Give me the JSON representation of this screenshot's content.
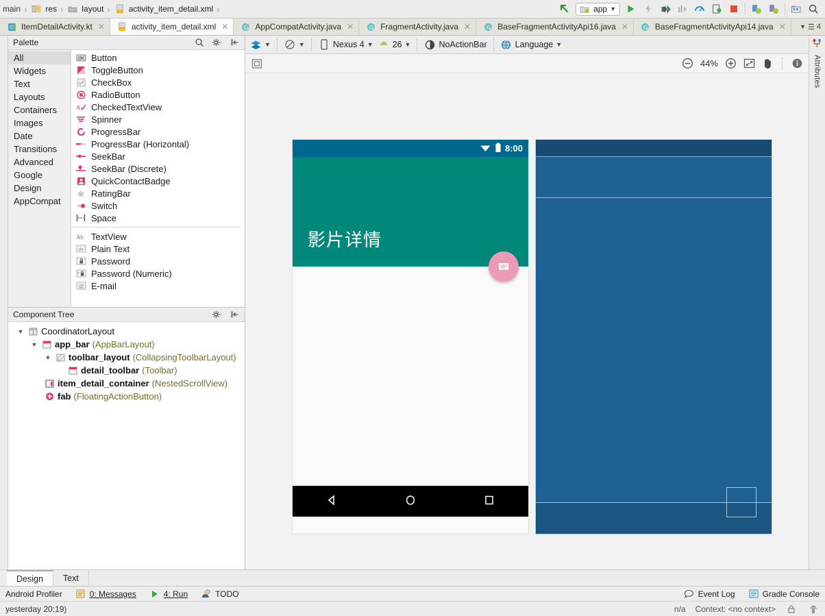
{
  "breadcrumb": {
    "items": [
      {
        "label": "main",
        "icon": "folder-icon"
      },
      {
        "label": "res",
        "icon": "res-folder-icon"
      },
      {
        "label": "layout",
        "icon": "folder-icon"
      },
      {
        "label": "activity_item_detail.xml",
        "icon": "xml-file-icon"
      }
    ],
    "separator": "›"
  },
  "toolbar": {
    "run_config_label": "app",
    "icons": [
      "pointer-icon",
      "run-icon",
      "apply-changes-icon",
      "debug-icon",
      "profile-icon",
      "monitor-icon",
      "attach-debugger-icon",
      "stop-icon",
      "avd-manager-icon",
      "sdk-manager-icon",
      "project-structure-icon",
      "search-everywhere-icon"
    ]
  },
  "editor_tabs": [
    {
      "label": "ItemDetailActivity.kt",
      "icon": "kotlin-file-icon",
      "active": false
    },
    {
      "label": "activity_item_detail.xml",
      "icon": "xml-file-icon",
      "active": true
    },
    {
      "label": "AppCompatActivity.java",
      "icon": "java-class-icon",
      "active": false
    },
    {
      "label": "FragmentActivity.java",
      "icon": "java-class-icon",
      "active": false
    },
    {
      "label": "BaseFragmentActivityApi16.java",
      "icon": "java-class-icon",
      "active": false
    },
    {
      "label": "BaseFragmentActivityApi14.java",
      "icon": "java-class-icon",
      "active": false
    }
  ],
  "tabstrip_right": {
    "count": "4",
    "icon": "tab-list-icon"
  },
  "palette": {
    "title": "Palette",
    "header_icons": [
      "search-icon",
      "gear-icon",
      "collapse-icon"
    ],
    "categories": [
      {
        "label": "All",
        "selected": true
      },
      {
        "label": "Widgets",
        "selected": false
      },
      {
        "label": "Text",
        "selected": false
      },
      {
        "label": "Layouts",
        "selected": false
      },
      {
        "label": "Containers",
        "selected": false
      },
      {
        "label": "Images",
        "selected": false
      },
      {
        "label": "Date",
        "selected": false
      },
      {
        "label": "Transitions",
        "selected": false
      },
      {
        "label": "Advanced",
        "selected": false
      },
      {
        "label": "Google",
        "selected": false
      },
      {
        "label": "Design",
        "selected": false
      },
      {
        "label": "AppCompat",
        "selected": false
      }
    ],
    "group1": [
      {
        "label": "Button",
        "icon": "button-icon"
      },
      {
        "label": "ToggleButton",
        "icon": "toggle-button-icon"
      },
      {
        "label": "CheckBox",
        "icon": "checkbox-icon"
      },
      {
        "label": "RadioButton",
        "icon": "radio-button-icon"
      },
      {
        "label": "CheckedTextView",
        "icon": "checked-text-view-icon"
      },
      {
        "label": "Spinner",
        "icon": "spinner-icon"
      },
      {
        "label": "ProgressBar",
        "icon": "progress-bar-icon"
      },
      {
        "label": "ProgressBar (Horizontal)",
        "icon": "progress-bar-horizontal-icon"
      },
      {
        "label": "SeekBar",
        "icon": "seekbar-icon"
      },
      {
        "label": "SeekBar (Discrete)",
        "icon": "seekbar-discrete-icon"
      },
      {
        "label": "QuickContactBadge",
        "icon": "quick-contact-badge-icon"
      },
      {
        "label": "RatingBar",
        "icon": "rating-bar-icon"
      },
      {
        "label": "Switch",
        "icon": "switch-icon"
      },
      {
        "label": "Space",
        "icon": "space-icon"
      }
    ],
    "group2": [
      {
        "label": "TextView",
        "icon": "text-view-icon"
      },
      {
        "label": "Plain Text",
        "icon": "plain-text-icon"
      },
      {
        "label": "Password",
        "icon": "password-icon"
      },
      {
        "label": "Password (Numeric)",
        "icon": "password-numeric-icon"
      },
      {
        "label": "E-mail",
        "icon": "email-icon"
      }
    ]
  },
  "component_tree": {
    "title": "Component Tree",
    "header_icons": [
      "gear-icon",
      "collapse-icon"
    ],
    "nodes": [
      {
        "indent": 0,
        "arrow": "▼",
        "icon": "coordinator-layout-icon",
        "id": "",
        "type": "CoordinatorLayout"
      },
      {
        "indent": 1,
        "arrow": "▼",
        "icon": "app-bar-layout-icon",
        "id": "app_bar",
        "type": "(AppBarLayout)"
      },
      {
        "indent": 2,
        "arrow": "▼",
        "icon": "collapsing-toolbar-icon",
        "id": "toolbar_layout",
        "type": "(CollapsingToolbarLayout)"
      },
      {
        "indent": 3,
        "arrow": "",
        "icon": "toolbar-icon",
        "id": "detail_toolbar",
        "type": "(Toolbar)"
      },
      {
        "indent": 1,
        "arrow": "",
        "icon": "nested-scroll-view-icon",
        "id": "item_detail_container",
        "type": "(NestedScrollView)"
      },
      {
        "indent": 1,
        "arrow": "",
        "icon": "floating-action-button-icon",
        "id": "fab",
        "type": "(FloatingActionButton)"
      }
    ]
  },
  "design_toolbar": {
    "design_mode_icon": "layers-icon",
    "orientation_icon": "orientation-icon",
    "device_icon": "phone-icon",
    "device": "Nexus 4",
    "api_icon": "android-icon",
    "api_level": "26",
    "theme_icon": "theme-icon",
    "theme": "NoActionBar",
    "locale_icon": "globe-icon",
    "locale": "Language"
  },
  "design_strip": {
    "pan_target_icon": "constraint-icon",
    "zoom_out_icon": "zoom-out-icon",
    "zoom_level": "44%",
    "zoom_in_icon": "zoom-in-icon",
    "zoom_fit_icon": "zoom-fit-icon",
    "pan_icon": "hand-icon",
    "info_icon": "info-icon"
  },
  "preview": {
    "status_time": "8:00",
    "status_icons": [
      "wifi-icon",
      "battery-icon"
    ],
    "title": "影片详情",
    "fab_icon": "email-icon",
    "nav_icons": [
      "back-icon",
      "home-icon",
      "recents-icon"
    ]
  },
  "colors": {
    "status_bar": "#00688f",
    "app_bar": "#00897b",
    "app_bar_teal": "#00897b",
    "fab": "#ec9bb6",
    "blueprint_bg": "#1f6193",
    "blueprint_dark": "#184b70",
    "blueprint_line": "#8cbcdc",
    "nav_bar": "#000000"
  },
  "bottom_tabs": [
    {
      "label": "Design",
      "active": true
    },
    {
      "label": "Text",
      "active": false
    }
  ],
  "status_bar": {
    "left_items": [
      {
        "label": "Android Profiler",
        "icon": "profiler-icon"
      },
      {
        "label": "0: Messages",
        "icon": "messages-icon"
      },
      {
        "label": "4: Run",
        "icon": "run-icon"
      },
      {
        "label": "TODO",
        "icon": "todo-icon"
      }
    ],
    "right_items": [
      {
        "label": "Event Log",
        "icon": "event-log-icon"
      },
      {
        "label": "Gradle Console",
        "icon": "gradle-console-icon"
      }
    ]
  },
  "status_bar2": {
    "message": "yesterday 20:19)",
    "position": "n/a",
    "context": "Context: <no context>",
    "icons": [
      "lock-icon",
      "memory-icon"
    ]
  },
  "right_sidebar": {
    "tabs": [
      {
        "label": "Attributes",
        "icon": "attributes-icon"
      }
    ]
  }
}
